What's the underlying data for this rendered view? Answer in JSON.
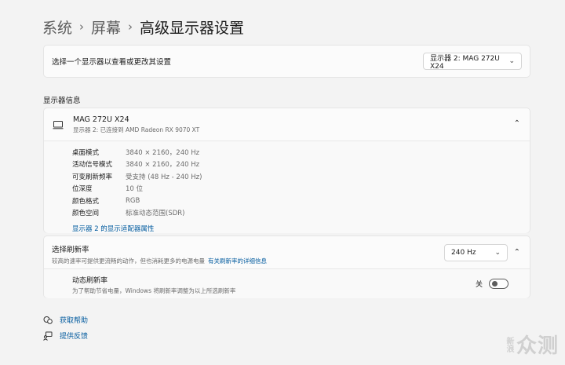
{
  "breadcrumb": {
    "item1": "系统",
    "item2": "屏幕",
    "current": "高级显示器设置",
    "sep": "›"
  },
  "display_select": {
    "label": "选择一个显示器以查看或更改其设置",
    "value": "显示器 2: MAG 272U X24"
  },
  "section_title": "显示器信息",
  "monitor": {
    "name": "MAG 272U X24",
    "sub": "显示器 2: 已连接到 AMD Radeon RX 9070 XT",
    "rows": [
      {
        "k": "桌面模式",
        "v": "3840 × 2160，240 Hz"
      },
      {
        "k": "活动信号模式",
        "v": "3840 × 2160，240 Hz"
      },
      {
        "k": "可变刷新频率",
        "v": "受支持 (48 Hz - 240 Hz)"
      },
      {
        "k": "位深度",
        "v": "10 位"
      },
      {
        "k": "颜色格式",
        "v": "RGB"
      },
      {
        "k": "颜色空间",
        "v": "标准动态范围(SDR)"
      }
    ],
    "adapter_link": "显示器 2 的显示适配器属性"
  },
  "refresh": {
    "title": "选择刷新率",
    "desc": "较高的速率可提供更流畅的动作，但也消耗更多的电源电量",
    "desc_link": "有关刷新率的详细信息",
    "value": "240 Hz"
  },
  "vrr": {
    "title": "动态刷新率",
    "desc": "为了帮助节省电量，Windows 将刷新率调整为以上所选刷新率",
    "state": "关"
  },
  "help": {
    "get_help": "获取帮助",
    "feedback": "提供反馈"
  },
  "watermark": {
    "small": "新浪",
    "big": "众测"
  },
  "icons": {
    "chevron_down": "chevron-down-icon",
    "chevron_up": "chevron-up-icon",
    "monitor": "monitor-icon"
  }
}
